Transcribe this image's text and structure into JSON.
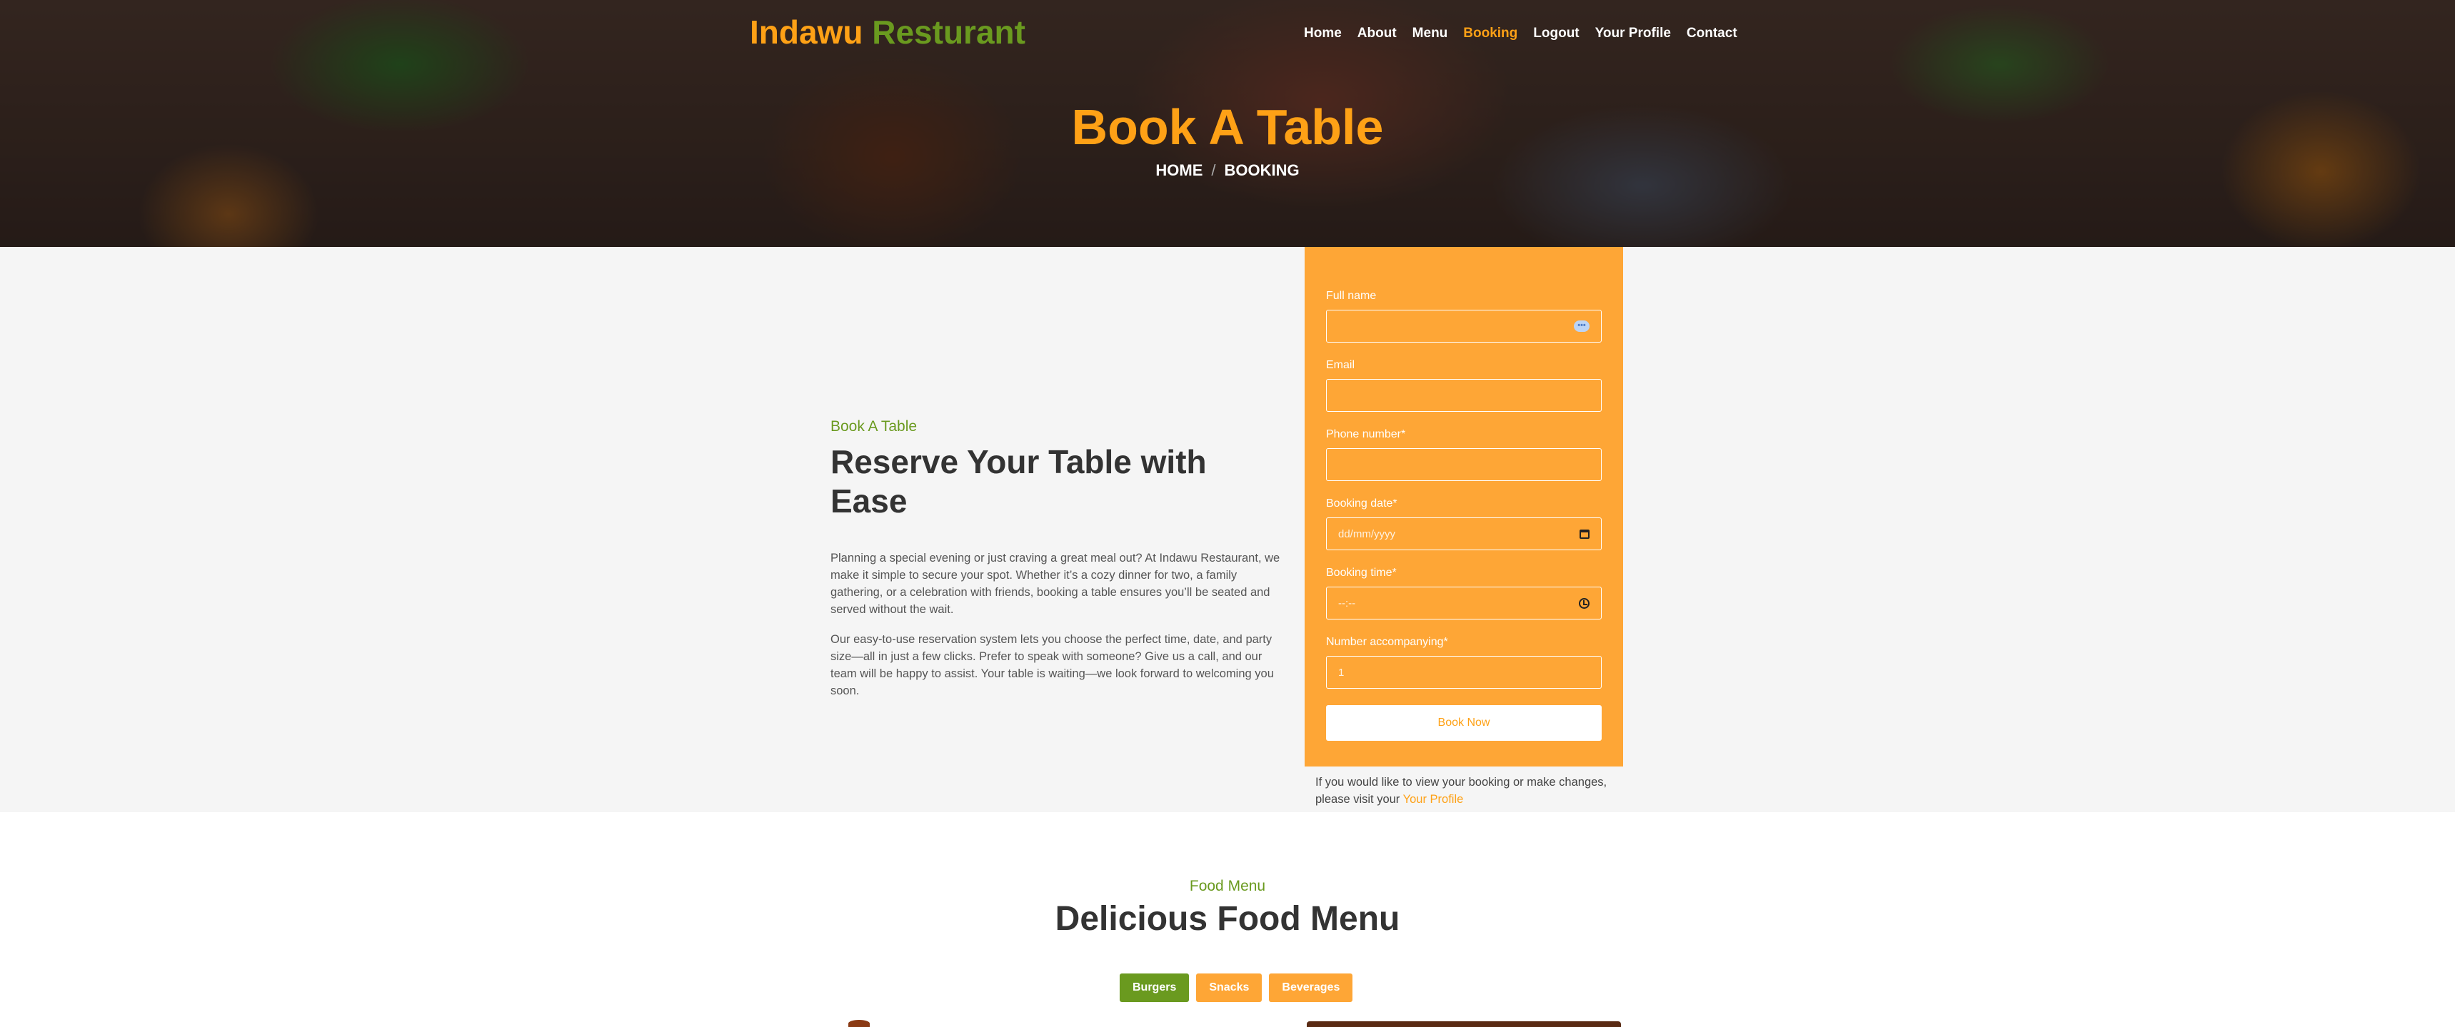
{
  "header": {
    "brand_part1": "Indawu",
    "brand_part2": "Resturant",
    "nav": [
      "Home",
      "About",
      "Menu",
      "Booking",
      "Logout",
      "Your Profile",
      "Contact"
    ],
    "active_nav": "Booking"
  },
  "hero": {
    "title": "Book A Table",
    "breadcrumb": [
      "HOME",
      "BOOKING"
    ]
  },
  "intro": {
    "eyebrow": "Book A Table",
    "heading": "Reserve Your Table with Ease",
    "paragraph1": "Planning a special evening or just craving a great meal out? At Indawu Restaurant, we make it simple to secure your spot. Whether it’s a cozy dinner for two, a family gathering, or a celebration with friends, booking a table ensures you’ll be seated and served without the wait.",
    "paragraph2": "Our easy-to-use reservation system lets you choose the perfect time, date, and party size—all in just a few clicks. Prefer to speak with someone? Give us a call, and our team will be happy to assist. Your table is waiting—we look forward to welcoming you soon."
  },
  "form": {
    "full_name_label": "Full name",
    "email_label": "Email",
    "phone_label": "Phone number*",
    "date_label": "Booking date*",
    "date_placeholder": "dd/mm/yyyy",
    "time_label": "Booking time*",
    "time_placeholder": "--:--",
    "people_label": "Number accompanying*",
    "people_value": "1",
    "submit_label": "Book Now",
    "note_text": "If you would like to view your booking or make changes, please visit your",
    "note_link": "Your Profile",
    "autofill_icon": "more-dots-icon"
  },
  "menu": {
    "eyebrow": "Food Menu",
    "title": "Delicious Food Menu",
    "tabs": [
      "Burgers",
      "Snacks",
      "Beverages"
    ],
    "active_tab": "Burgers"
  },
  "colors": {
    "accent_orange": "#fea116",
    "form_orange": "#fea636",
    "accent_green": "#6a9a1f"
  }
}
